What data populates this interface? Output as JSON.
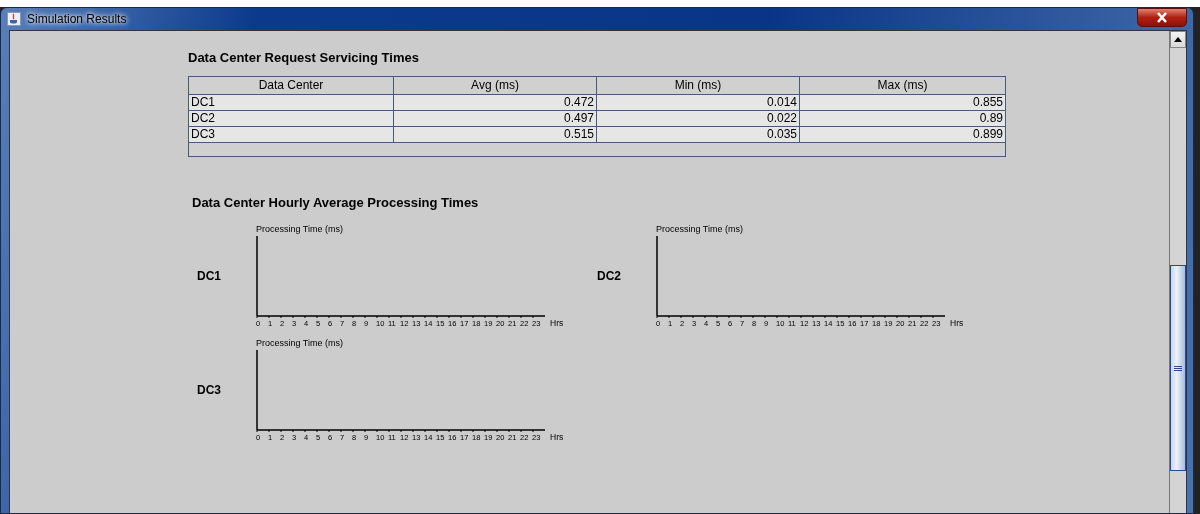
{
  "window": {
    "title": "Simulation Results"
  },
  "servicing": {
    "title": "Data Center Request Servicing Times",
    "columns": [
      "Data Center",
      "Avg (ms)",
      "Min (ms)",
      "Max (ms)"
    ],
    "rows": [
      [
        "DC1",
        "0.472",
        "0.014",
        "0.855"
      ],
      [
        "DC2",
        "0.497",
        "0.022",
        "0.89"
      ],
      [
        "DC3",
        "0.515",
        "0.035",
        "0.899"
      ]
    ]
  },
  "hourly": {
    "title": "Data Center Hourly Average Processing Times",
    "charts": [
      {
        "label": "DC1",
        "y_title": "Processing Time (ms)",
        "x_ticks": [
          "0",
          "1",
          "2",
          "3",
          "4",
          "5",
          "6",
          "7",
          "8",
          "9",
          "10",
          "11",
          "12",
          "13",
          "14",
          "15",
          "16",
          "17",
          "18",
          "19",
          "20",
          "21",
          "22",
          "23"
        ],
        "x_unit": "Hrs"
      },
      {
        "label": "DC2",
        "y_title": "Processing Time (ms)",
        "x_ticks": [
          "0",
          "1",
          "2",
          "3",
          "4",
          "5",
          "6",
          "7",
          "8",
          "9",
          "10",
          "11",
          "12",
          "13",
          "14",
          "15",
          "16",
          "17",
          "18",
          "19",
          "20",
          "21",
          "22",
          "23"
        ],
        "x_unit": "Hrs"
      },
      {
        "label": "DC3",
        "y_title": "Processing Time (ms)",
        "x_ticks": [
          "0",
          "1",
          "2",
          "3",
          "4",
          "5",
          "6",
          "7",
          "8",
          "9",
          "10",
          "11",
          "12",
          "13",
          "14",
          "15",
          "16",
          "17",
          "18",
          "19",
          "20",
          "21",
          "22",
          "23"
        ],
        "x_unit": "Hrs"
      }
    ]
  }
}
